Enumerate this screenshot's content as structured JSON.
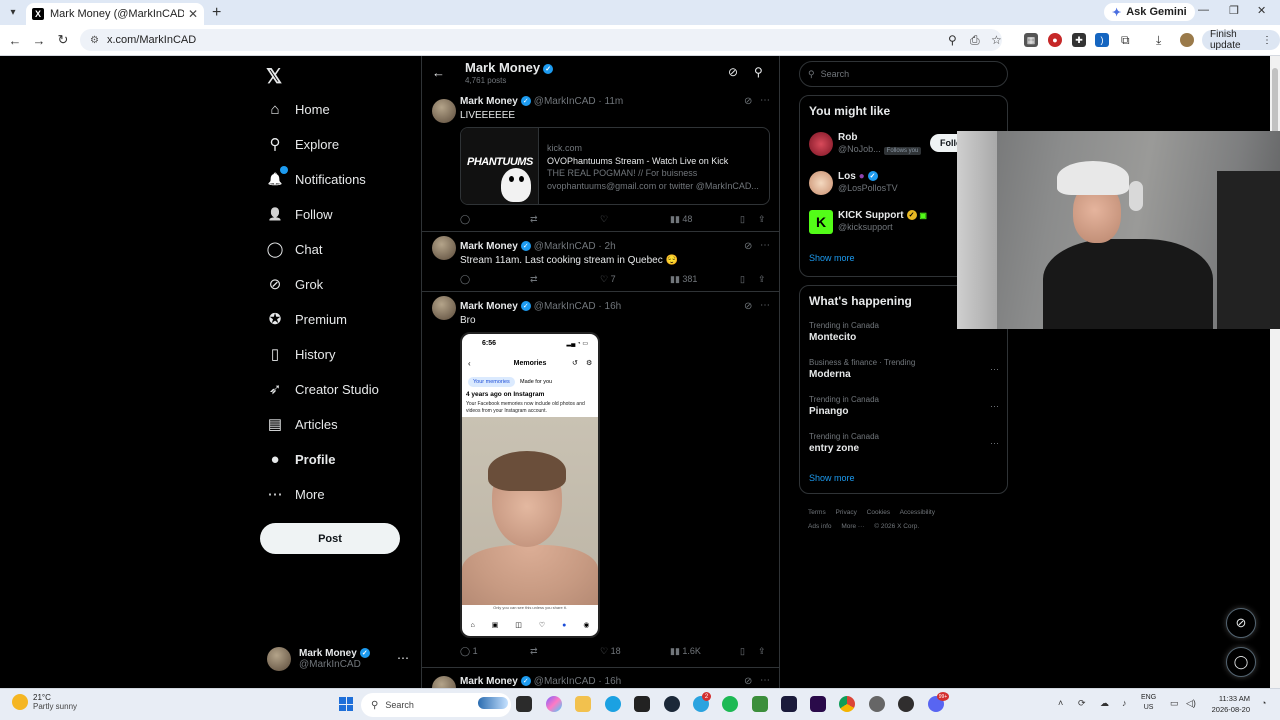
{
  "browser": {
    "tab_title": "Mark Money (@MarkInCAD) / X",
    "tab_favicon": "X",
    "new_tab": "+",
    "gemini_label": "Ask Gemini",
    "url": "x.com/MarkInCAD",
    "finish_update": "Finish update",
    "winctl": {
      "min": "—",
      "max": "❐",
      "close": "✕"
    },
    "tab_close": "✕"
  },
  "nav": {
    "logo": "𝕏",
    "items": [
      {
        "label": "Home",
        "icon": "home-icon",
        "glyph": "⌂"
      },
      {
        "label": "Explore",
        "icon": "search-icon",
        "glyph": "⚲"
      },
      {
        "label": "Notifications",
        "icon": "bell-icon",
        "glyph": "🔔"
      },
      {
        "label": "Follow",
        "icon": "person-add-icon",
        "glyph": "👤"
      },
      {
        "label": "Chat",
        "icon": "chat-icon",
        "glyph": "◯"
      },
      {
        "label": "Grok",
        "icon": "grok-icon",
        "glyph": "⊘"
      },
      {
        "label": "Premium",
        "icon": "premium-icon",
        "glyph": "✪"
      },
      {
        "label": "History",
        "icon": "bookmark-icon",
        "glyph": "▯"
      },
      {
        "label": "Creator Studio",
        "icon": "rocket-icon",
        "glyph": "➶"
      },
      {
        "label": "Articles",
        "icon": "articles-icon",
        "glyph": "▤"
      },
      {
        "label": "Profile",
        "icon": "profile-icon",
        "glyph": "●"
      },
      {
        "label": "More",
        "icon": "more-circle-icon",
        "glyph": "⋯"
      }
    ],
    "post_button": "Post",
    "account_name": "Mark Money",
    "account_handle": "@MarkInCAD",
    "account_more": "⋯"
  },
  "profile": {
    "name": "Mark Money",
    "post_count": "4,761 posts"
  },
  "tweets": [
    {
      "name": "Mark Money",
      "meta": "@MarkInCAD · 11m",
      "text": "LIVEEEEEE",
      "card": {
        "brand": "PHANTUUMS",
        "domain": "kick.com",
        "title": "OVOPhantuums Stream - Watch Live on Kick",
        "desc1": "THE REAL POGMAN! // For buisness",
        "desc2": "ovophantuums@gmail.com or twitter @MarkInCAD..."
      },
      "replies": "",
      "reposts": "",
      "likes": "",
      "views": "48"
    },
    {
      "name": "Mark Money",
      "meta": "@MarkInCAD · 2h",
      "text": "Stream 11am. Last cooking stream in Quebec 😌",
      "replies": "",
      "reposts": "",
      "likes": "7",
      "views": "381"
    },
    {
      "name": "Mark Money",
      "meta": "@MarkInCAD · 16h",
      "text": "Bro",
      "screenshot": {
        "time": "6:56",
        "title": "Memories",
        "tab1": "Your memories",
        "tab2": "Made for you",
        "heading": "4 years ago on Instagram",
        "desc": "Your Facebook memories now include old photos and videos from your Instagram account.",
        "caption": "Only you can see this unless you share it."
      },
      "replies": "1",
      "reposts": "",
      "likes": "18",
      "views": "1.6K"
    },
    {
      "name": "Mark Money",
      "meta": "@MarkInCAD · 16h"
    }
  ],
  "right": {
    "search_placeholder": "Search",
    "you_might_like": "You might like",
    "suggestions": [
      {
        "name": "Rob",
        "handle": "@NoJob...",
        "follows_you": "Follows you",
        "follow": "Follow"
      },
      {
        "name": "Los",
        "handle": "@LosPollosTV"
      },
      {
        "name": "KICK Support",
        "handle": "@kicksupport",
        "logo": "K"
      }
    ],
    "show_more": "Show more",
    "whats_happening": "What's happening",
    "trends": [
      {
        "category": "Trending in Canada",
        "name": "Montecito"
      },
      {
        "category": "Business & finance · Trending",
        "name": "Moderna"
      },
      {
        "category": "Trending in Canada",
        "name": "Pinango"
      },
      {
        "category": "Trending in Canada",
        "name": "entry zone"
      }
    ],
    "show_more_2": "Show more",
    "footer": [
      "Terms",
      "Privacy",
      "Cookies",
      "Accessibility",
      "Ads info",
      "More ···",
      "© 2026 X Corp."
    ]
  },
  "taskbar": {
    "temp": "21°C",
    "condition": "Partly sunny",
    "search": "Search",
    "badge1": "2",
    "badge2": "99+",
    "lang1": "ENG",
    "lang2": "US",
    "time": "11:33 AM",
    "date": "2026-08-20"
  },
  "colors": {
    "accent": "#1d9bf0",
    "bg": "#000000",
    "border": "#2f3336",
    "muted": "#71767b"
  }
}
